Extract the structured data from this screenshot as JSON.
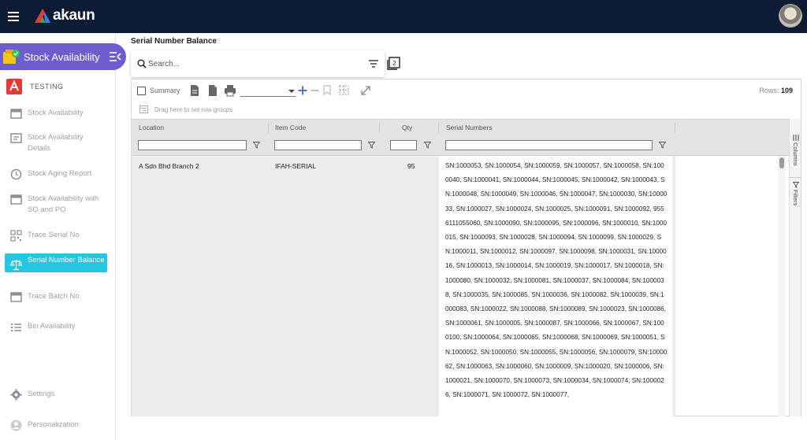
{
  "app": {
    "name": "akaun"
  },
  "module": {
    "title": "Stock Availability"
  },
  "tenant": {
    "label": "TESTING"
  },
  "sidebar": {
    "items": [
      {
        "label": "Stock Availability",
        "icon": "box-icon"
      },
      {
        "label": "Stock Availability Details",
        "icon": "details-icon"
      },
      {
        "label": "Stock Aging Report",
        "icon": "clock-icon"
      },
      {
        "label": "Stock Availability with SO and PO",
        "icon": "box-icon"
      },
      {
        "label": "Trace Serial No",
        "icon": "qr-icon"
      },
      {
        "label": "Serial Number Balance",
        "icon": "scale-icon",
        "active": true
      },
      {
        "label": "Trace Batch No",
        "icon": "box-icon"
      },
      {
        "label": "Bin Availability",
        "icon": "list-icon"
      }
    ],
    "footer": [
      {
        "label": "Settings",
        "icon": "gear-icon"
      },
      {
        "label": "Personalization",
        "icon": "user-icon"
      }
    ]
  },
  "page": {
    "title": "Serial Number Balance"
  },
  "search": {
    "placeholder": "Search..."
  },
  "toolbar": {
    "summary_label": "Summary",
    "select_value": "",
    "rows_label": "Rows:",
    "rows_count": "109"
  },
  "groupbar": {
    "text": "Drag here to set row groups"
  },
  "grid": {
    "columns": [
      "Location",
      "Item Code",
      "Qty",
      "Serial Numbers"
    ],
    "rows": [
      {
        "location": "A Sdn Bhd Branch 2",
        "item_code": "IFAH-SERIAL",
        "qty": "95",
        "serial_numbers": "SN:1000053, SN:1000054, SN:1000059, SN:1000057, SN:1000058, SN:1000040, SN:1000041, SN:1000044, SN:1000045, SN:1000042, SN:1000043, SN:1000048, SN:1000049, SN:1000046, SN:1000047, SN:1000030, SN:1000033, SN:1000027, SN:1000024, SN:1000025, SN:1000091, SN:1000092, 9556111055060, SN:1000090, SN:1000095, SN:1000096, SN:1000010, SN:1000015, SN:1000093, SN:1000028, SN:1000094, SN:1000099, SN:1000029, SN:1000011, SN:1000012, SN:1000097, SN:1000098, SN:1000031, SN:1000016, SN:1000013, SN:1000014, SN:1000019, SN:1000017, SN:1000018, SN:1000080, SN:1000032, SN:1000081, SN:1000037, SN:1000084, SN:1000038, SN:1000035, SN:1000085, SN:1000036, SN:1000082, SN:1000039, SN:1000083, SN:1000022, SN:1000088, SN:1000089, SN:1000023, SN:1000086, SN:1000061, SN:1000005, SN:1000087, SN:1000066, SN:1000067, SN:1000100, SN:1000064, SN:1000065, SN:1000068, SN:1000069, SN:1000051, SN:1000052, SN:1000050, SN:1000055, SN:1000056, SN:1000079, SN:1000062, SN:1000063, SN:1000060, SN:1000009, SN:1000020, SN:1000006, SN:1000021, SN:1000070, SN:1000073, SN:1000034, SN:1000074, SN:1000026, SN:1000071, SN:1000072, SN:1000077,"
      }
    ]
  },
  "right_panel": {
    "columns_tab": "Columns",
    "filters_tab": "Filters"
  },
  "colors": {
    "topbar": "#0d1b34",
    "module_pill": "#6c5ecf",
    "active_nav": "#26c6e2",
    "accent_blue": "#2f6fd6"
  }
}
